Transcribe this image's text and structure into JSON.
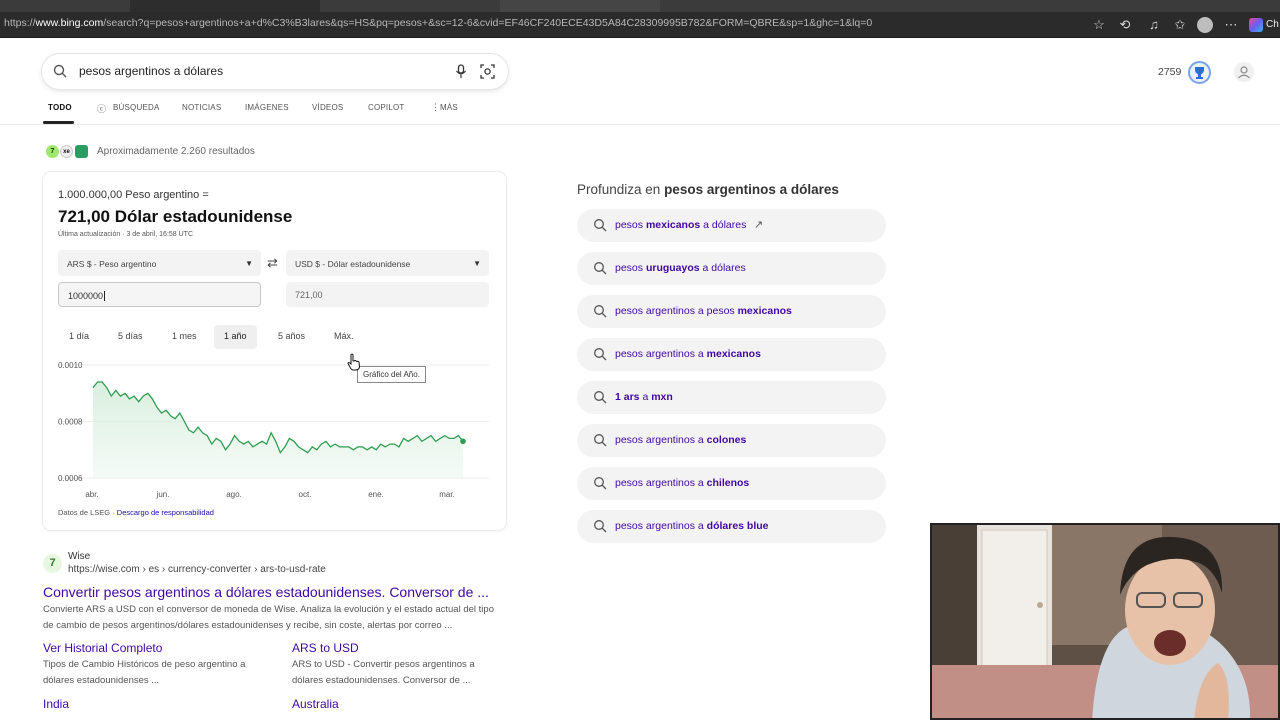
{
  "browser": {
    "url_prefix": "https://",
    "url_host": "www.bing.com",
    "url_rest": "/search?q=pesos+argentinos+a+d%C3%B3lares&qs=HS&pq=pesos+&sc=12-6&cvid=EF46CF240ECE43D5A84C28309995B782&FORM=QBRE&sp=1&ghc=1&lq=0",
    "profile_initial": "Ch"
  },
  "search": {
    "query": "pesos argentinos a dólares",
    "reward_points": "2759"
  },
  "nav": {
    "tabs": [
      "TODO",
      "BÚSQUEDA",
      "NOTICIAS",
      "IMÁGENES",
      "VÍDEOS",
      "COPILOT",
      "MÁS"
    ]
  },
  "results": {
    "count_text": "Aproximadamente 2.260 resultados",
    "providers": [
      "7",
      "xe",
      ""
    ]
  },
  "converter": {
    "from_line": "1.000.000,00 Peso argentino =",
    "to_line": "721,00 Dólar estadounidense",
    "updated": "Última actualización · 3 de abril, 16:58 UTC",
    "from_currency": "ARS $ - Peso argentino",
    "to_currency": "USD $ - Dólar estadounidense",
    "from_amount": "1000000",
    "to_amount": "721,00",
    "ranges": [
      "1 día",
      "5 días",
      "1 mes",
      "1 año",
      "5 años",
      "Máx."
    ],
    "active_range": "1 año",
    "tooltip": "Gráfico del Año.",
    "source_prefix": "Datos de LSEG · ",
    "source_link": "Descargo de responsabilidad"
  },
  "chart_data": {
    "type": "area",
    "x_tick_labels": [
      "abr.",
      "jun.",
      "ago.",
      "oct.",
      "ene.",
      "mar."
    ],
    "y_tick_labels": [
      "0.0010",
      "0.0008",
      "0.0006"
    ],
    "ylim": [
      0.0006,
      0.001
    ],
    "series": [
      {
        "values": [
          0.00092,
          0.00094,
          0.00094,
          0.00092,
          0.00089,
          0.00091,
          0.00089,
          0.0009,
          0.00088,
          0.00089,
          0.00087,
          0.00089,
          0.0009,
          0.00088,
          0.00085,
          0.00083,
          0.00084,
          0.00082,
          0.00081,
          0.00083,
          0.0008,
          0.00077,
          0.00076,
          0.00078,
          0.00076,
          0.00075,
          0.00072,
          0.00074,
          0.00073,
          0.0007,
          0.00072,
          0.00075,
          0.00073,
          0.00072,
          0.00073,
          0.00071,
          0.00072,
          0.00073,
          0.00072,
          0.00076,
          0.00073,
          0.00069,
          0.00071,
          0.00074,
          0.00073,
          0.00071,
          0.0007,
          0.00069,
          0.00071,
          0.0007,
          0.00072,
          0.00073,
          0.00071,
          0.00072,
          0.00071,
          0.00071,
          0.00071,
          0.0007,
          0.00071,
          0.00071,
          0.0007,
          0.00071,
          0.0007,
          0.00072,
          0.00071,
          0.00072,
          0.00072,
          0.00071,
          0.00074,
          0.00073,
          0.00074,
          0.00075,
          0.00073,
          0.00074,
          0.00075,
          0.00073,
          0.00074,
          0.00075,
          0.00074,
          0.00074,
          0.00075,
          0.00073
        ]
      }
    ],
    "colors": {
      "line": "#2e9e4f",
      "fill": "#d9efdf"
    }
  },
  "wise": {
    "site": "Wise",
    "url": "https://wise.com › es › currency-converter › ars-to-usd-rate",
    "title": "Convertir pesos argentinos a dólares estadounidenses. Conversor de ...",
    "snippet": "Convierte ARS a USD con el conversor de moneda de Wise. Analiza la evolución y el estado actual del tipo de cambio de pesos argentinos/dólares estadounidenses y recibe, sin coste, alertas por correo ...",
    "sublinks": [
      {
        "title": "Ver Historial Completo",
        "text": "Tipos de Cambio Históricos de peso argentino a dólares estadounidenses ..."
      },
      {
        "title": "ARS to USD",
        "text": "ARS to USD - Convertir pesos argentinos a dólares estadounidenses. Conversor de ..."
      },
      {
        "title": "India",
        "text": ""
      },
      {
        "title": "Australia",
        "text": ""
      }
    ]
  },
  "related": {
    "title_prefix": "Profundiza en ",
    "title_bold": "pesos argentinos a dólares",
    "items": [
      {
        "pre": "pesos ",
        "bold": "mexicanos",
        "post": " a dólares",
        "trend": true
      },
      {
        "pre": "pesos ",
        "bold": "uruguayos",
        "post": " a dólares",
        "trend": false
      },
      {
        "pre": "pesos argentinos a pesos ",
        "bold": "mexicanos",
        "post": "",
        "trend": false
      },
      {
        "pre": "pesos argentinos a ",
        "bold": "mexicanos",
        "post": "",
        "trend": false
      },
      {
        "pre": "",
        "bold": "1 ars",
        "post": " a ",
        "bold2": "mxn",
        "trend": false
      },
      {
        "pre": "pesos argentinos a ",
        "bold": "colones",
        "post": "",
        "trend": false
      },
      {
        "pre": "pesos argentinos a ",
        "bold": "chilenos",
        "post": "",
        "trend": false
      },
      {
        "pre": "pesos argentinos a ",
        "bold": "dólares blue",
        "post": "",
        "trend": false
      }
    ]
  }
}
